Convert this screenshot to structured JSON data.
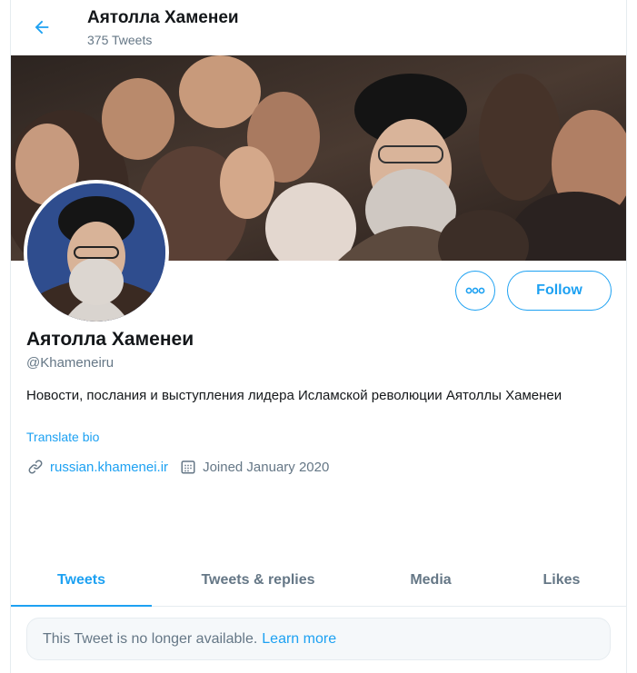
{
  "header": {
    "back_icon": "arrow-left-icon",
    "name": "Аятолла Хаменеи",
    "tweet_count": "375 Tweets"
  },
  "profile": {
    "display_name": "Аятолла Хаменеи",
    "handle": "@Khameneiru",
    "bio": "Новости, послания и выступления лидера Исламской революции Аятоллы Хаменеи",
    "translate_label": "Translate bio",
    "website": "russian.khamenei.ir",
    "joined": "Joined January 2020",
    "link_icon": "link-icon",
    "calendar_icon": "calendar-icon"
  },
  "actions": {
    "more_icon": "more-icon",
    "follow_label": "Follow"
  },
  "tabs": [
    {
      "label": "Tweets",
      "active": true
    },
    {
      "label": "Tweets & replies",
      "active": false
    },
    {
      "label": "Media",
      "active": false
    },
    {
      "label": "Likes",
      "active": false
    }
  ],
  "notice": {
    "text": "This Tweet is no longer available.",
    "link": "Learn more"
  },
  "colors": {
    "accent": "#1da1f2",
    "text_primary": "#14171a",
    "text_secondary": "#657786",
    "border": "#e6ecf0"
  }
}
